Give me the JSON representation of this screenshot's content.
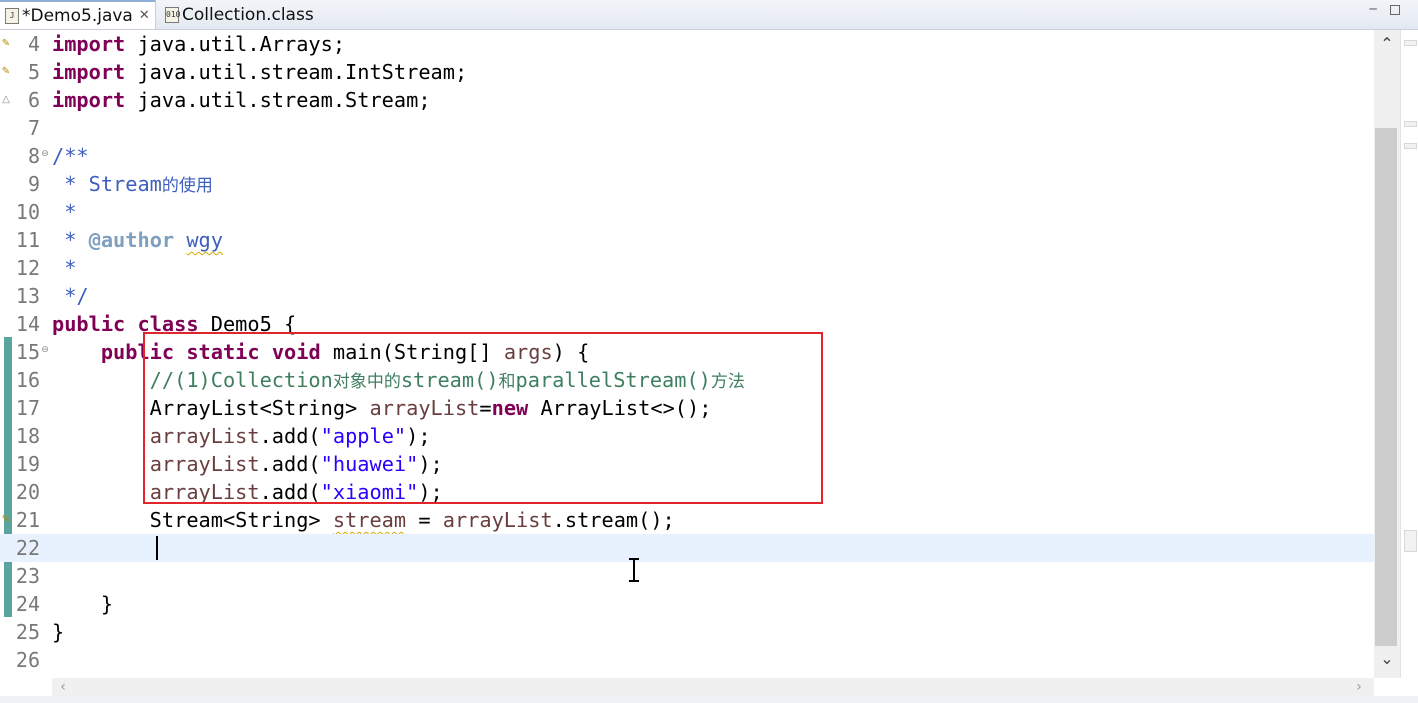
{
  "tabs": [
    {
      "label": "*Demo5.java",
      "icon": "java-file-icon",
      "active": true
    },
    {
      "label": "Collection.class",
      "icon": "class-file-icon",
      "active": false
    }
  ],
  "editor": {
    "lines": [
      {
        "num": "4",
        "tokens": [
          {
            "t": "import",
            "c": "kw"
          },
          {
            "t": " java.util.Arrays;"
          }
        ]
      },
      {
        "num": "5",
        "tokens": [
          {
            "t": "import",
            "c": "kw"
          },
          {
            "t": " java.util.stream.IntStream;"
          }
        ]
      },
      {
        "num": "6",
        "tokens": [
          {
            "t": "import",
            "c": "kw"
          },
          {
            "t": " java.util.stream.Stream;"
          }
        ]
      },
      {
        "num": "7",
        "tokens": []
      },
      {
        "num": "8",
        "fold": true,
        "tokens": [
          {
            "t": "/**",
            "c": "doc"
          }
        ]
      },
      {
        "num": "9",
        "tokens": [
          {
            "t": " * Stream",
            "c": "doc"
          },
          {
            "t": "的使用",
            "c": "doc cjk"
          }
        ]
      },
      {
        "num": "10",
        "tokens": [
          {
            "t": " *",
            "c": "doc"
          }
        ]
      },
      {
        "num": "11",
        "tokens": [
          {
            "t": " * ",
            "c": "doc"
          },
          {
            "t": "@author",
            "c": "tag"
          },
          {
            "t": " ",
            "c": "doc"
          },
          {
            "t": "wgy",
            "c": "doc squig"
          }
        ]
      },
      {
        "num": "12",
        "tokens": [
          {
            "t": " *",
            "c": "doc"
          }
        ]
      },
      {
        "num": "13",
        "tokens": [
          {
            "t": " */",
            "c": "doc"
          }
        ]
      },
      {
        "num": "14",
        "tokens": [
          {
            "t": "public",
            "c": "kw"
          },
          {
            "t": " "
          },
          {
            "t": "class",
            "c": "kw"
          },
          {
            "t": " Demo5 {"
          }
        ]
      },
      {
        "num": "15",
        "fold": true,
        "tokens": [
          {
            "t": "    "
          },
          {
            "t": "public",
            "c": "kw"
          },
          {
            "t": " "
          },
          {
            "t": "static",
            "c": "kw"
          },
          {
            "t": " "
          },
          {
            "t": "void",
            "c": "kw"
          },
          {
            "t": " main(String[] "
          },
          {
            "t": "args",
            "c": "var"
          },
          {
            "t": ") {"
          }
        ]
      },
      {
        "num": "16",
        "tokens": [
          {
            "t": "        //(1)Collection",
            "c": "cmt"
          },
          {
            "t": "对象中的",
            "c": "cmt cjk"
          },
          {
            "t": "stream()",
            "c": "cmt"
          },
          {
            "t": "和",
            "c": "cmt cjk"
          },
          {
            "t": "parallelStream()",
            "c": "cmt"
          },
          {
            "t": "方法",
            "c": "cmt cjk"
          }
        ]
      },
      {
        "num": "17",
        "tokens": [
          {
            "t": "        ArrayList<String> "
          },
          {
            "t": "arrayList",
            "c": "var"
          },
          {
            "t": "="
          },
          {
            "t": "new",
            "c": "kw"
          },
          {
            "t": " ArrayList<>();"
          }
        ]
      },
      {
        "num": "18",
        "tokens": [
          {
            "t": "        "
          },
          {
            "t": "arrayList",
            "c": "var"
          },
          {
            "t": ".add("
          },
          {
            "t": "\"apple\"",
            "c": "str"
          },
          {
            "t": ");"
          }
        ]
      },
      {
        "num": "19",
        "tokens": [
          {
            "t": "        "
          },
          {
            "t": "arrayList",
            "c": "var"
          },
          {
            "t": ".add("
          },
          {
            "t": "\"huawei\"",
            "c": "str"
          },
          {
            "t": ");"
          }
        ]
      },
      {
        "num": "20",
        "tokens": [
          {
            "t": "        "
          },
          {
            "t": "arrayList",
            "c": "var"
          },
          {
            "t": ".add("
          },
          {
            "t": "\"xiaomi\"",
            "c": "str"
          },
          {
            "t": ");"
          }
        ]
      },
      {
        "num": "21",
        "tokens": [
          {
            "t": "        Stream<String> "
          },
          {
            "t": "stream",
            "c": "var squig"
          },
          {
            "t": " = "
          },
          {
            "t": "arrayList",
            "c": "var"
          },
          {
            "t": ".stream();"
          }
        ]
      },
      {
        "num": "22",
        "current": true,
        "tokens": []
      },
      {
        "num": "23",
        "tokens": []
      },
      {
        "num": "24",
        "tokens": [
          {
            "t": "    }"
          }
        ]
      },
      {
        "num": "25",
        "tokens": [
          {
            "t": "}"
          }
        ]
      },
      {
        "num": "26",
        "tokens": []
      }
    ]
  },
  "colors": {
    "keyword": "#7f0055",
    "javadoc": "#3f5fbf",
    "comment": "#3f7f5f",
    "string": "#2a00ff",
    "local_variable": "#6a3e3e",
    "highlight_box": "#e0262b",
    "current_line": "#e8f2fe"
  }
}
